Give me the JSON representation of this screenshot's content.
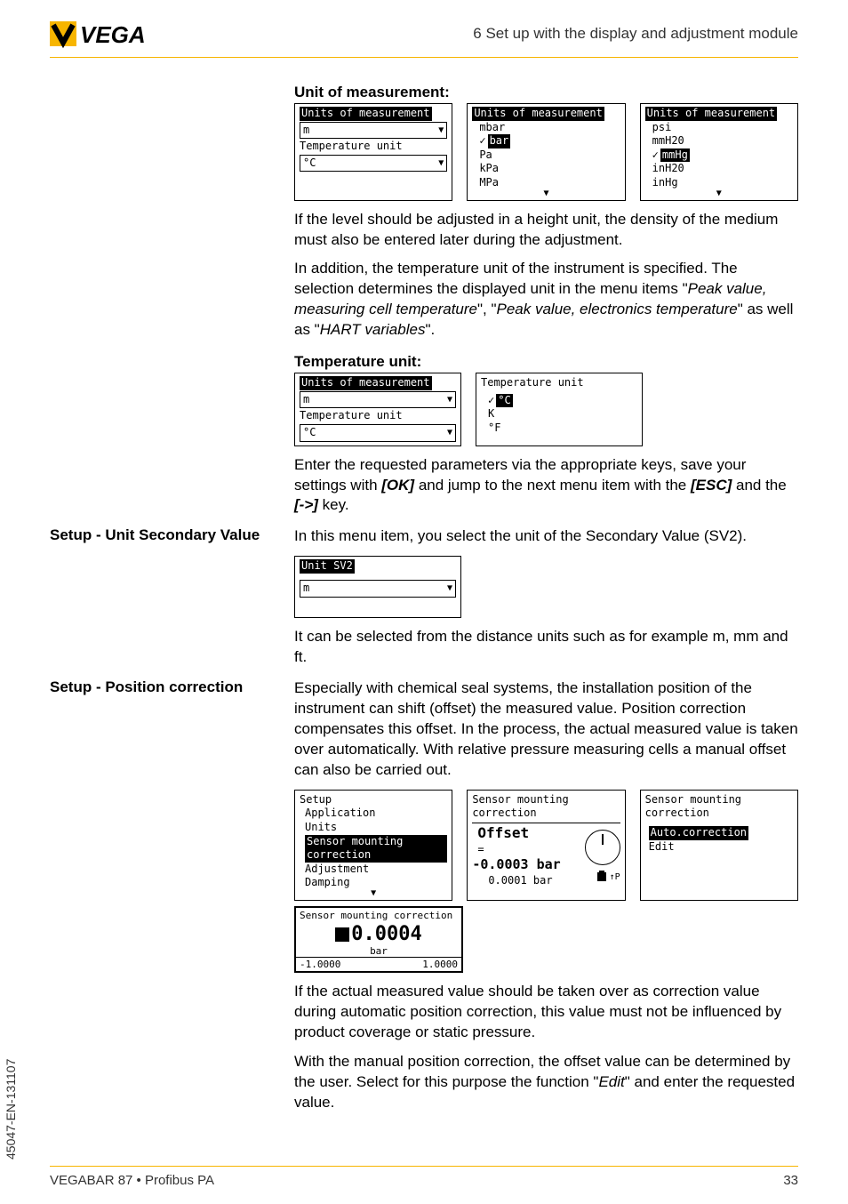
{
  "header": {
    "section_title": "6 Set up with the display and adjustment module",
    "logo_text": "VEGA"
  },
  "unit_of_measurement": {
    "heading": "Unit of measurement:",
    "screen1": {
      "line1": "Units of measurement",
      "field1": "m",
      "line2": "Temperature unit",
      "field2": "°C"
    },
    "screen2": {
      "title": "Units of measurement",
      "opts": [
        "mbar",
        "bar",
        "Pa",
        "kPa",
        "MPa"
      ],
      "selected_index": 1
    },
    "screen3": {
      "title": "Units of measurement",
      "opts": [
        "psi",
        "mmH20",
        "mmHg",
        "inH20",
        "inHg"
      ],
      "selected_index": 2
    },
    "para1": "If the level should be adjusted in a height unit, the density of the medium must also be entered later during the adjustment.",
    "para2a": "In addition, the temperature unit of the instrument is specified. The selection determines the displayed unit in the menu items \"",
    "para2b": "Peak value, measuring cell temperature",
    "para2c": "\", \"",
    "para2d": "Peak value, electronics temperature",
    "para2e": "\" as well as \"",
    "para2f": "HART variables",
    "para2g": "\"."
  },
  "temperature_unit": {
    "heading": "Temperature unit:",
    "screen1": {
      "line1": "Units of measurement",
      "field1": "m",
      "line2": "Temperature unit",
      "field2": "°C"
    },
    "screen2": {
      "title": "Temperature unit",
      "opts": [
        "°C",
        "K",
        "°F"
      ],
      "selected_index": 0
    },
    "para1a": "Enter the requested parameters via the appropriate keys, save your settings with ",
    "para1b": "[OK]",
    "para1c": " and jump to the next menu item with the ",
    "para1d": "[ESC]",
    "para1e": " and the ",
    "para1f": "[->]",
    "para1g": " key."
  },
  "secondary_value": {
    "side_heading": "Setup - Unit Secondary Value",
    "para1": "In this menu item, you select the unit of the Secondary Value (SV2).",
    "screen1": {
      "title": "Unit SV2",
      "field1": "m"
    },
    "para2": "It can be selected from the distance units such as for example m, mm and ft."
  },
  "position_correction": {
    "side_heading": "Setup - Position correction",
    "para1": "Especially with chemical seal systems, the installation position of the instrument can shift (offset) the measured value. Position correction compensates this offset. In the process, the actual measured value is taken over automatically. With relative pressure measuring cells a manual offset can also be carried out.",
    "screen1": {
      "title": "Setup",
      "items": [
        "Application",
        "Units",
        "Sensor mounting correction",
        "Adjustment",
        "Damping"
      ],
      "selected_index": 2
    },
    "screen2": {
      "title": "Sensor mounting correction",
      "offset_label": "Offset",
      "eq": "=",
      "value": "-0.0003 bar",
      "sub": "0.0001 bar",
      "tp": "↑P"
    },
    "screen3": {
      "title": "Sensor mounting correction",
      "opts": [
        "Auto.correction",
        "Edit"
      ],
      "selected_index": 0
    },
    "screen4": {
      "title": "Sensor mounting correction",
      "big_value": "0.0004",
      "unit": "bar",
      "range_lo": "-1.0000",
      "range_hi": "1.0000"
    },
    "para2": "If the actual measured value should be taken over as correction value during automatic position correction, this value must not be influenced by product coverage or static pressure.",
    "para3a": "With the manual position correction, the offset value can be determined by the user. Select for this purpose the function \"",
    "para3b": "Edit",
    "para3c": "\" and enter the requested value."
  },
  "side_doc_id": "45047-EN-131107",
  "footer": {
    "left": "VEGABAR 87 • Profibus PA",
    "right": "33"
  }
}
